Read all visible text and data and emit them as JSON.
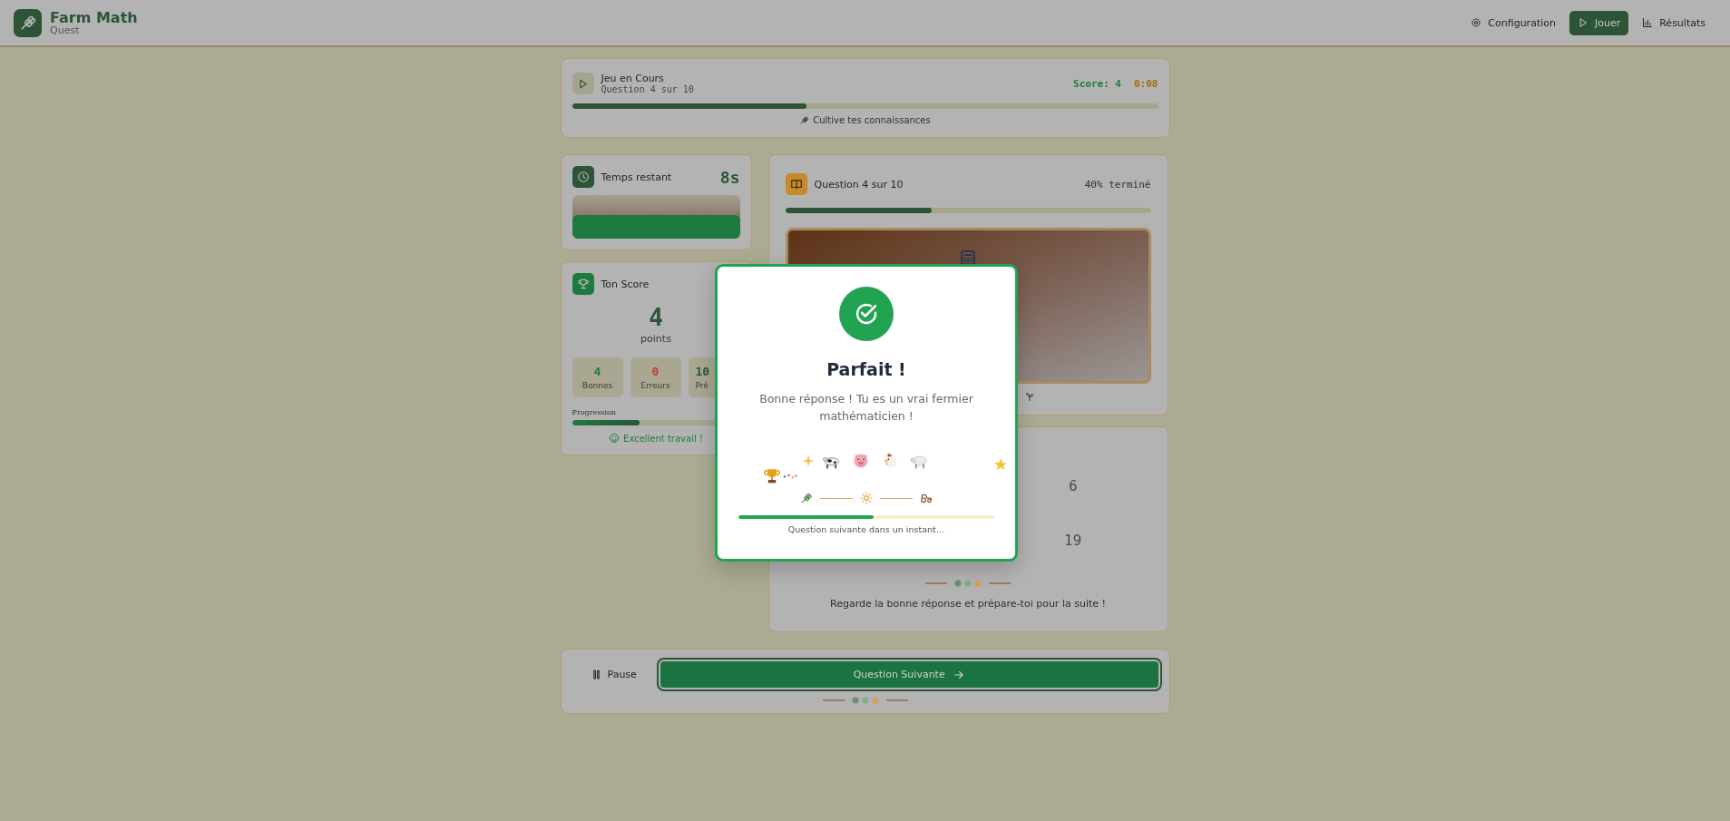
{
  "header": {
    "app_name": "Farm Math",
    "app_subtitle": "Quest",
    "nav": [
      {
        "label": "Configuration",
        "selected": false
      },
      {
        "label": "Jouer",
        "selected": true
      },
      {
        "label": "Résultats",
        "selected": false
      }
    ]
  },
  "game_status": {
    "title": "Jeu en Cours",
    "subtitle": "Question 4 sur 10",
    "score": "Score: 4",
    "time": "0:08",
    "level": 0.4,
    "tagline": "Cultive tes connaissances"
  },
  "timer": {
    "title": "Temps restant",
    "value": "8s"
  },
  "score_card": {
    "title": "Ton Score",
    "points": "4",
    "points_label": "points",
    "stats": [
      {
        "value": "4",
        "label": "Bonnes",
        "color": "#1f7a3f"
      },
      {
        "value": "0",
        "label": "Erreurs",
        "color": "#c4392e"
      },
      {
        "value": "10",
        "label": "Pré",
        "color": "#2d5437"
      }
    ],
    "progress_label": "Progression",
    "level": 0.4,
    "message": "Excellent travail !"
  },
  "question": {
    "title": "Question 4 sur 10",
    "completion": "40% terminé",
    "level": 0.4
  },
  "answers": {
    "options": [
      "6",
      "19"
    ],
    "hint": "Regarde la bonne réponse et prépare-toi pour la suite !"
  },
  "controls": {
    "pause": "Pause",
    "next": "Question Suivante"
  },
  "feedback": {
    "title": "Parfait !",
    "message": "Bonne réponse ! Tu es un vrai fermier mathématicien !",
    "level": 0.53,
    "caption": "Question suivante dans un instant…"
  }
}
